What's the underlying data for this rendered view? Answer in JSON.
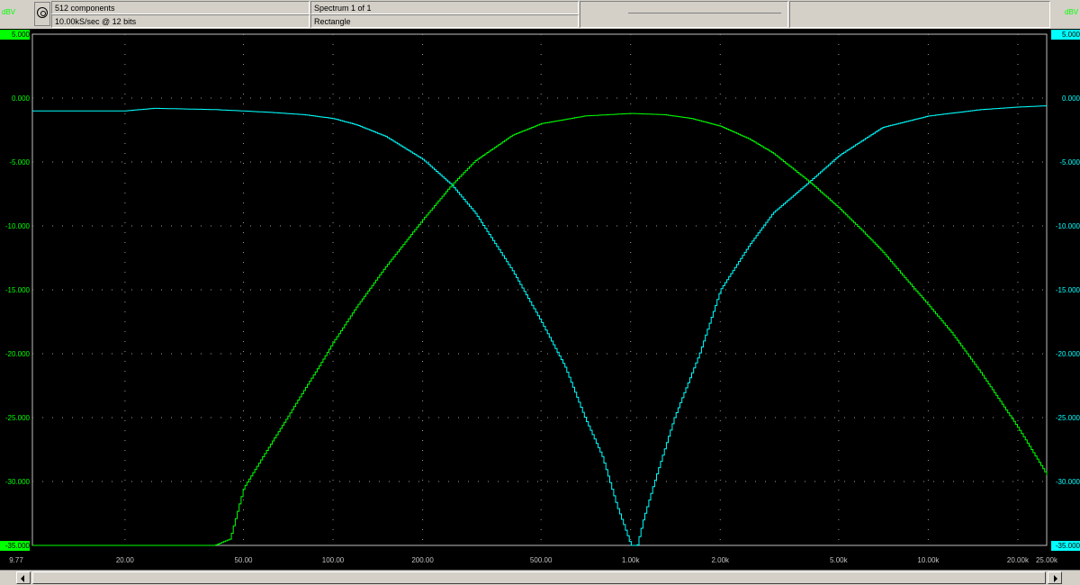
{
  "header": {
    "components": "512 components",
    "sample_rate": "10.00kS/sec @ 12 bits",
    "spectrum": "Spectrum 1 of 1",
    "window": "Rectangle"
  },
  "units": {
    "left": "dBV",
    "right": "dBV"
  },
  "colors": {
    "green": "#00ff00",
    "cyan": "#00ffff",
    "grid": "#9a9a9a",
    "frame": "#c0c0c0"
  },
  "chart_data": {
    "type": "line",
    "x_scale": "log",
    "xlim": [
      9.77,
      25000
    ],
    "ylim": [
      -35,
      5
    ],
    "x_ticks": [
      {
        "value": 9.77,
        "label": "9.77"
      },
      {
        "value": 20,
        "label": "20.00"
      },
      {
        "value": 50,
        "label": "50.00"
      },
      {
        "value": 100,
        "label": "100.00"
      },
      {
        "value": 200,
        "label": "200.00"
      },
      {
        "value": 500,
        "label": "500.00"
      },
      {
        "value": 1000,
        "label": "1.00k"
      },
      {
        "value": 2000,
        "label": "2.00k"
      },
      {
        "value": 5000,
        "label": "5.00k"
      },
      {
        "value": 10000,
        "label": "10.00k"
      },
      {
        "value": 20000,
        "label": "20.00k"
      },
      {
        "value": 25000,
        "label": "25.00k"
      }
    ],
    "y_ticks": [
      {
        "value": 5,
        "label": "5.000"
      },
      {
        "value": 0,
        "label": "0.000"
      },
      {
        "value": -5,
        "label": "-5.000"
      },
      {
        "value": -10,
        "label": "-10.000"
      },
      {
        "value": -15,
        "label": "-15.000"
      },
      {
        "value": -20,
        "label": "-20.000"
      },
      {
        "value": -25,
        "label": "-25.000"
      },
      {
        "value": -30,
        "label": "-30.000"
      },
      {
        "value": -35,
        "label": "-35.000"
      }
    ],
    "grid": true,
    "series": [
      {
        "color": "#00ffff",
        "x": [
          9.77,
          20,
          25,
          40,
          60,
          80,
          100,
          120,
          150,
          200,
          250,
          300,
          400,
          500,
          600,
          700,
          800,
          900,
          950,
          1000,
          1050,
          1100,
          1200,
          1400,
          1700,
          2000,
          2500,
          3000,
          4000,
          5000,
          7000,
          10000,
          15000,
          20000,
          25000
        ],
        "y": [
          -1.0,
          -1.0,
          -0.8,
          -0.9,
          -1.1,
          -1.3,
          -1.6,
          -2.1,
          -3.0,
          -4.8,
          -6.8,
          -9.0,
          -13.5,
          -17.5,
          -21.0,
          -25.0,
          -28.0,
          -32.0,
          -33.5,
          -35.0,
          -35.0,
          -33.0,
          -30.0,
          -25.0,
          -20.0,
          -15.0,
          -11.5,
          -9.0,
          -6.5,
          -4.5,
          -2.3,
          -1.4,
          -0.9,
          -0.7,
          -0.6
        ]
      },
      {
        "color": "#00ff00",
        "x": [
          9.77,
          40,
          45,
          50,
          60,
          70,
          80,
          90,
          100,
          120,
          150,
          200,
          250,
          300,
          400,
          500,
          700,
          1000,
          1300,
          1600,
          2000,
          2500,
          3000,
          4000,
          5000,
          6000,
          7000,
          8000,
          10000,
          12000,
          15000,
          20000,
          25000
        ],
        "y": [
          -35.0,
          -35.0,
          -34.5,
          -30.5,
          -27.5,
          -25.0,
          -22.8,
          -20.9,
          -19.1,
          -16.3,
          -13.2,
          -9.5,
          -6.8,
          -4.9,
          -2.9,
          -2.0,
          -1.4,
          -1.2,
          -1.3,
          -1.6,
          -2.2,
          -3.2,
          -4.3,
          -6.6,
          -8.6,
          -10.4,
          -12.0,
          -13.6,
          -16.2,
          -18.4,
          -21.5,
          -25.8,
          -29.5
        ]
      }
    ]
  }
}
